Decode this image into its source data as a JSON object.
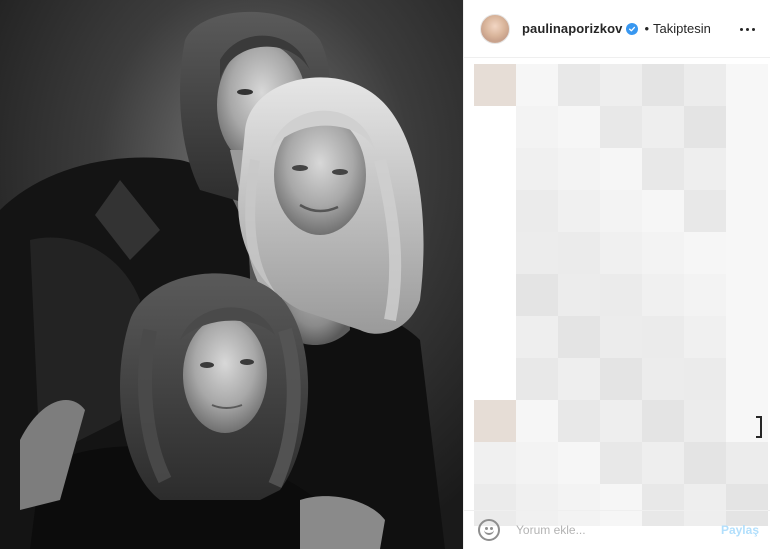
{
  "post": {
    "header": {
      "username": "paulinaporizkov",
      "verified": true,
      "separator": "•",
      "follow_status": "Takiptesin",
      "avatar_icon": "profile-avatar"
    },
    "footer": {
      "comment_placeholder": "Yorum ekle...",
      "share_label": "Paylaş"
    },
    "photo": {
      "icon": "black-and-white-family-portrait"
    },
    "colors": {
      "verified_badge": "#3897f0",
      "text": "#262626",
      "border": "#efefef",
      "share_disabled": "#b2dffc"
    }
  }
}
